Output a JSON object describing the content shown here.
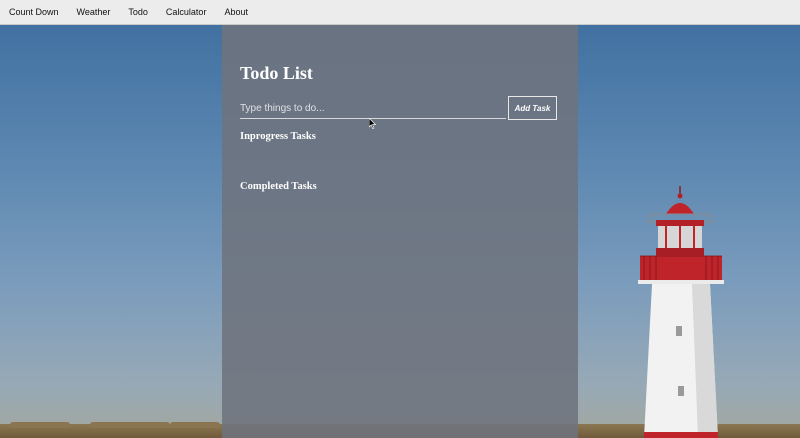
{
  "nav": {
    "items": [
      "Count Down",
      "Weather",
      "Todo",
      "Calculator",
      "About"
    ]
  },
  "todo": {
    "title": "Todo List",
    "input_placeholder": "Type things to do...",
    "input_value": "",
    "add_button_label": "Add Task",
    "inprogress_heading": "Inprogress Tasks",
    "completed_heading": "Completed Tasks",
    "inprogress_tasks": [],
    "completed_tasks": []
  },
  "colors": {
    "sky_top": "#3d6d9e",
    "sky_bottom": "#97a9b6",
    "panel_overlay": "#6e737d",
    "lighthouse_red": "#c0242b",
    "lighthouse_white": "#f2f2f2"
  },
  "icons": {
    "cursor": "mouse-pointer-icon"
  }
}
